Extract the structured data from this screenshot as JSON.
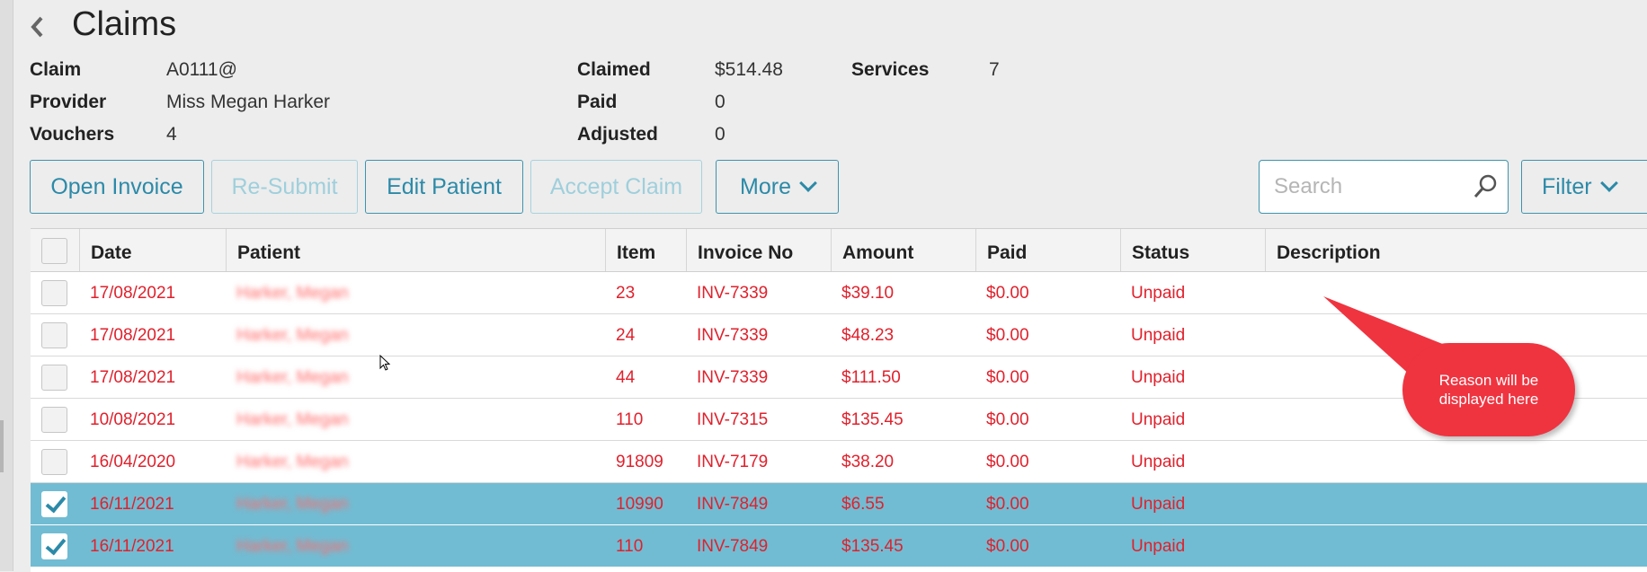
{
  "header": {
    "title": "Claims",
    "back_icon": "chevron-left-icon"
  },
  "summary": {
    "claim_label": "Claim",
    "claim_value": "A0111@",
    "provider_label": "Provider",
    "provider_value": "Miss Megan Harker",
    "vouchers_label": "Vouchers",
    "vouchers_value": "4",
    "claimed_label": "Claimed",
    "claimed_value": "$514.48",
    "paid_label": "Paid",
    "paid_value": "0",
    "adjusted_label": "Adjusted",
    "adjusted_value": "0",
    "services_label": "Services",
    "services_value": "7"
  },
  "toolbar": {
    "open_invoice": "Open Invoice",
    "resubmit": "Re-Submit",
    "edit_patient": "Edit Patient",
    "accept_claim": "Accept Claim",
    "more": "More",
    "search_placeholder": "Search",
    "filter": "Filter"
  },
  "table": {
    "columns": [
      "Date",
      "Patient",
      "Item",
      "Invoice No",
      "Amount",
      "Paid",
      "Status",
      "Description"
    ],
    "rows": [
      {
        "date": "17/08/2021",
        "patient": "Harker, Megan",
        "item": "23",
        "invoice": "INV-7339",
        "amount": "$39.10",
        "paid": "$0.00",
        "status": "Unpaid",
        "description": "",
        "checked": false
      },
      {
        "date": "17/08/2021",
        "patient": "Harker, Megan",
        "item": "24",
        "invoice": "INV-7339",
        "amount": "$48.23",
        "paid": "$0.00",
        "status": "Unpaid",
        "description": "",
        "checked": false
      },
      {
        "date": "17/08/2021",
        "patient": "Harker, Megan",
        "item": "44",
        "invoice": "INV-7339",
        "amount": "$111.50",
        "paid": "$0.00",
        "status": "Unpaid",
        "description": "",
        "checked": false
      },
      {
        "date": "10/08/2021",
        "patient": "Harker, Megan",
        "item": "110",
        "invoice": "INV-7315",
        "amount": "$135.45",
        "paid": "$0.00",
        "status": "Unpaid",
        "description": "",
        "checked": false
      },
      {
        "date": "16/04/2020",
        "patient": "Harker, Megan",
        "item": "91809",
        "invoice": "INV-7179",
        "amount": "$38.20",
        "paid": "$0.00",
        "status": "Unpaid",
        "description": "",
        "checked": false
      },
      {
        "date": "16/11/2021",
        "patient": "Harker, Megan",
        "item": "10990",
        "invoice": "INV-7849",
        "amount": "$6.55",
        "paid": "$0.00",
        "status": "Unpaid",
        "description": "",
        "checked": true
      },
      {
        "date": "16/11/2021",
        "patient": "Harker, Megan",
        "item": "110",
        "invoice": "INV-7849",
        "amount": "$135.45",
        "paid": "$0.00",
        "status": "Unpaid",
        "description": "",
        "checked": true
      }
    ]
  },
  "annotation": {
    "line1": "Reason will be",
    "line2": "displayed here"
  },
  "colors": {
    "accent": "#2c8aa8",
    "unpaid": "#e0212c",
    "selected_row": "#71bcd3",
    "callout": "#ef3440"
  }
}
